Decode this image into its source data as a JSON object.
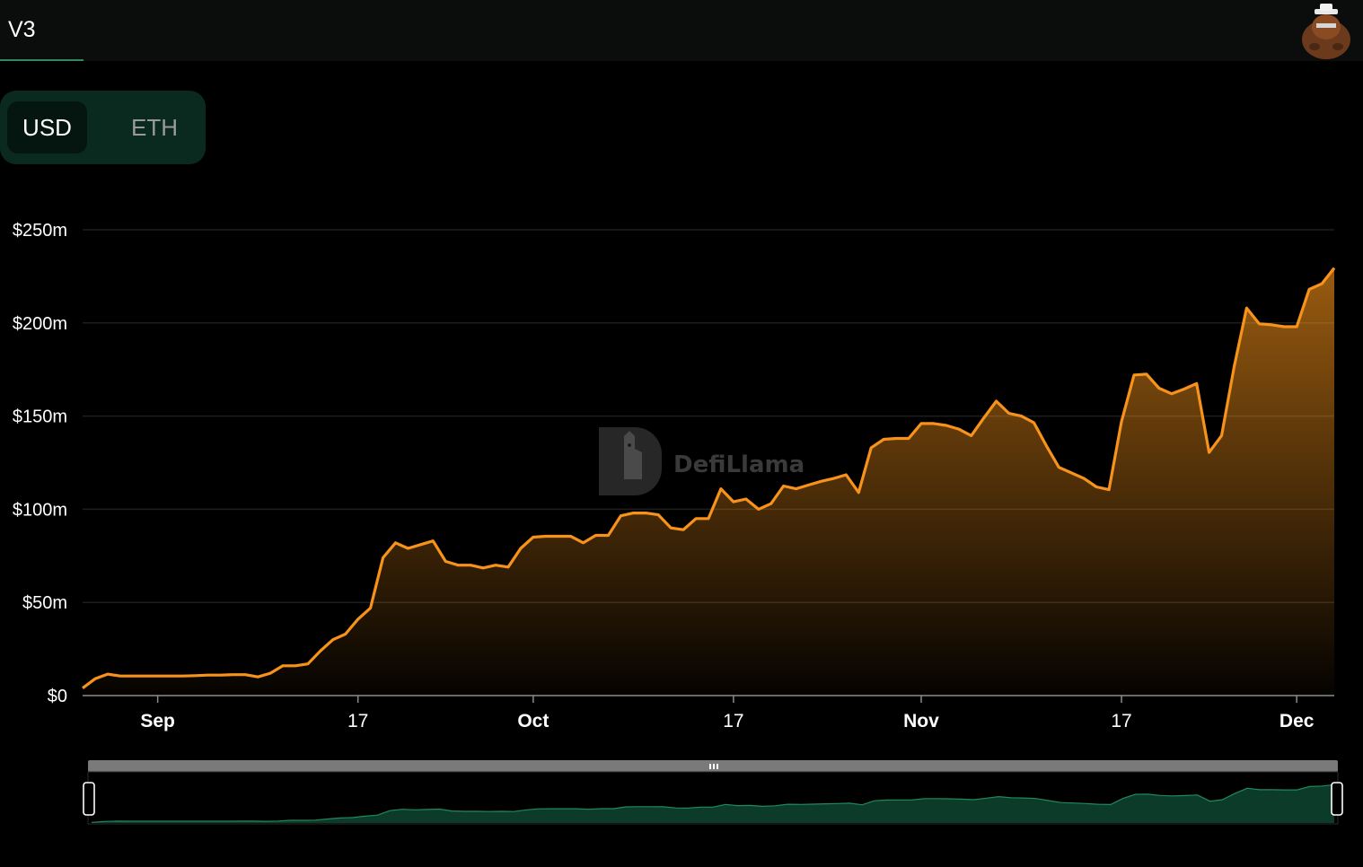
{
  "header": {
    "tab_label": "V3"
  },
  "currency_toggle": {
    "options": [
      "USD",
      "ETH"
    ],
    "selected": "USD"
  },
  "watermark": {
    "text": "DefiLlama"
  },
  "colors": {
    "line": "#f7931a",
    "area_top": "#f7931a",
    "background": "#000000",
    "accent_green": "#2f8a5c",
    "brush_fill": "#0c3b2a",
    "brush_line": "#1f8a5c"
  },
  "icons": {
    "avatar": "llama-avatar-icon",
    "brush_handle": "drag-handle-icon"
  },
  "chart_data": {
    "type": "area",
    "title": "",
    "xlabel": "",
    "ylabel": "",
    "y_unit": "USD",
    "ylim": [
      0,
      250
    ],
    "yticks": [
      {
        "value": 0,
        "label": "$0"
      },
      {
        "value": 50,
        "label": "$50m"
      },
      {
        "value": 100,
        "label": "$100m"
      },
      {
        "value": 150,
        "label": "$150m"
      },
      {
        "value": 200,
        "label": "$200m"
      },
      {
        "value": 250,
        "label": "$250m"
      }
    ],
    "xlim": [
      "2023-08-26",
      "2023-12-02"
    ],
    "xticks": [
      {
        "date": "2023-09-01",
        "label": "Sep",
        "bold": true
      },
      {
        "date": "2023-09-17",
        "label": "17",
        "bold": false
      },
      {
        "date": "2023-10-01",
        "label": "Oct",
        "bold": true
      },
      {
        "date": "2023-10-17",
        "label": "17",
        "bold": false
      },
      {
        "date": "2023-11-01",
        "label": "Nov",
        "bold": true
      },
      {
        "date": "2023-11-17",
        "label": "17",
        "bold": false
      },
      {
        "date": "2023-12-01",
        "label": "Dec",
        "bold": true
      }
    ],
    "grid": true,
    "series": [
      {
        "points": [
          [
            "2023-08-26",
            4
          ],
          [
            "2023-08-27",
            9
          ],
          [
            "2023-08-28",
            11.5
          ],
          [
            "2023-08-29",
            10.5
          ],
          [
            "2023-08-30",
            10.5
          ],
          [
            "2023-08-31",
            10.5
          ],
          [
            "2023-09-01",
            10.5
          ],
          [
            "2023-09-02",
            10.5
          ],
          [
            "2023-09-03",
            10.5
          ],
          [
            "2023-09-04",
            10.7
          ],
          [
            "2023-09-05",
            11
          ],
          [
            "2023-09-06",
            11
          ],
          [
            "2023-09-07",
            11.2
          ],
          [
            "2023-09-08",
            11.2
          ],
          [
            "2023-09-09",
            10
          ],
          [
            "2023-09-10",
            12
          ],
          [
            "2023-09-11",
            16
          ],
          [
            "2023-09-12",
            16
          ],
          [
            "2023-09-13",
            17
          ],
          [
            "2023-09-14",
            24
          ],
          [
            "2023-09-15",
            30
          ],
          [
            "2023-09-16",
            33
          ],
          [
            "2023-09-17",
            41
          ],
          [
            "2023-09-18",
            47
          ],
          [
            "2023-09-19",
            74
          ],
          [
            "2023-09-20",
            82
          ],
          [
            "2023-09-21",
            79
          ],
          [
            "2023-09-22",
            81
          ],
          [
            "2023-09-23",
            83
          ],
          [
            "2023-09-24",
            72
          ],
          [
            "2023-09-25",
            70
          ],
          [
            "2023-09-26",
            70
          ],
          [
            "2023-09-27",
            68.5
          ],
          [
            "2023-09-28",
            70
          ],
          [
            "2023-09-29",
            69
          ],
          [
            "2023-09-30",
            79
          ],
          [
            "2023-10-01",
            85
          ],
          [
            "2023-10-02",
            85.5
          ],
          [
            "2023-10-03",
            85.5
          ],
          [
            "2023-10-04",
            85.5
          ],
          [
            "2023-10-05",
            82
          ],
          [
            "2023-10-06",
            86
          ],
          [
            "2023-10-07",
            86
          ],
          [
            "2023-10-08",
            96.5
          ],
          [
            "2023-10-09",
            98
          ],
          [
            "2023-10-10",
            98
          ],
          [
            "2023-10-11",
            97
          ],
          [
            "2023-10-12",
            90
          ],
          [
            "2023-10-13",
            89
          ],
          [
            "2023-10-14",
            95
          ],
          [
            "2023-10-15",
            95
          ],
          [
            "2023-10-16",
            111
          ],
          [
            "2023-10-17",
            104
          ],
          [
            "2023-10-18",
            105.5
          ],
          [
            "2023-10-19",
            100
          ],
          [
            "2023-10-20",
            103
          ],
          [
            "2023-10-21",
            112.5
          ],
          [
            "2023-10-22",
            111
          ],
          [
            "2023-10-23",
            113
          ],
          [
            "2023-10-24",
            115
          ],
          [
            "2023-10-25",
            116.5
          ],
          [
            "2023-10-26",
            118.5
          ],
          [
            "2023-10-27",
            109
          ],
          [
            "2023-10-28",
            133
          ],
          [
            "2023-10-29",
            137.5
          ],
          [
            "2023-10-30",
            138
          ],
          [
            "2023-10-31",
            138
          ],
          [
            "2023-11-01",
            146
          ],
          [
            "2023-11-02",
            146
          ],
          [
            "2023-11-03",
            145
          ],
          [
            "2023-11-04",
            143
          ],
          [
            "2023-11-05",
            139.5
          ],
          [
            "2023-11-06",
            149
          ],
          [
            "2023-11-07",
            158
          ],
          [
            "2023-11-08",
            151.5
          ],
          [
            "2023-11-09",
            150
          ],
          [
            "2023-11-10",
            146.5
          ],
          [
            "2023-11-11",
            134
          ],
          [
            "2023-11-12",
            122.5
          ],
          [
            "2023-11-13",
            119.5
          ],
          [
            "2023-11-14",
            116.5
          ],
          [
            "2023-11-15",
            112
          ],
          [
            "2023-11-16",
            110.5
          ],
          [
            "2023-11-17",
            147
          ],
          [
            "2023-11-18",
            172
          ],
          [
            "2023-11-19",
            172.5
          ],
          [
            "2023-11-20",
            165
          ],
          [
            "2023-11-21",
            162
          ],
          [
            "2023-11-22",
            164.5
          ],
          [
            "2023-11-23",
            167.5
          ],
          [
            "2023-11-24",
            130.5
          ],
          [
            "2023-11-25",
            139.5
          ],
          [
            "2023-11-26",
            176.5
          ],
          [
            "2023-11-27",
            208
          ],
          [
            "2023-11-28",
            199.5
          ],
          [
            "2023-11-29",
            199
          ],
          [
            "2023-11-30",
            198
          ],
          [
            "2023-12-01",
            198
          ],
          [
            "2023-12-02",
            218
          ],
          [
            "2023-12-03",
            221
          ],
          [
            "2023-12-04",
            229.5
          ]
        ]
      }
    ],
    "legend": "none"
  }
}
